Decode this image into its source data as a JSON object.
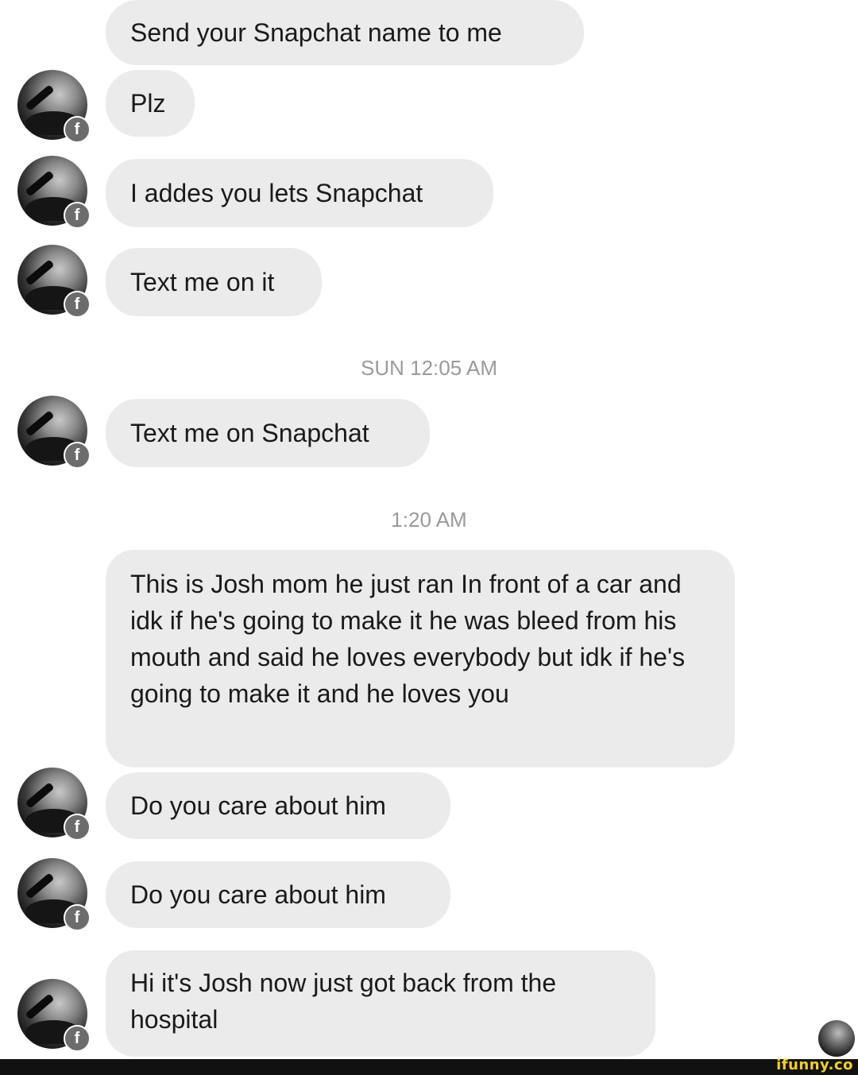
{
  "messages": [
    {
      "text": "Send your Snapchat name to me",
      "avatar": false
    },
    {
      "text": "Plz",
      "avatar": true,
      "badge": "f"
    },
    {
      "text": "I addes you lets Snapchat",
      "avatar": true,
      "badge": "f"
    },
    {
      "text": "Text me on it",
      "avatar": true,
      "badge": "f"
    },
    {
      "timestamp": "SUN 12:05 AM"
    },
    {
      "text": "Text me on Snapchat",
      "avatar": true,
      "badge": "f"
    },
    {
      "timestamp": "1:20 AM"
    },
    {
      "text": "This is Josh mom he just ran In front of a car and idk if he's going to make it he was bleed from his mouth and said he loves everybody but idk if he's going to make it and he loves you",
      "avatar": false
    },
    {
      "text": "Do you care about him",
      "avatar": true,
      "badge": "f"
    },
    {
      "text": "Do you care about him",
      "avatar": true,
      "badge": "f"
    },
    {
      "text": "Hi it's Josh now just got back from the hospital",
      "avatar": true,
      "badge": "f"
    }
  ],
  "seen_indicator": {
    "icon": "profile-photo"
  },
  "watermark": "ifunny.co",
  "colors": {
    "bubble": "#ebebeb",
    "timestamp": "#9a9a9a",
    "watermark": "#f4d21a"
  }
}
